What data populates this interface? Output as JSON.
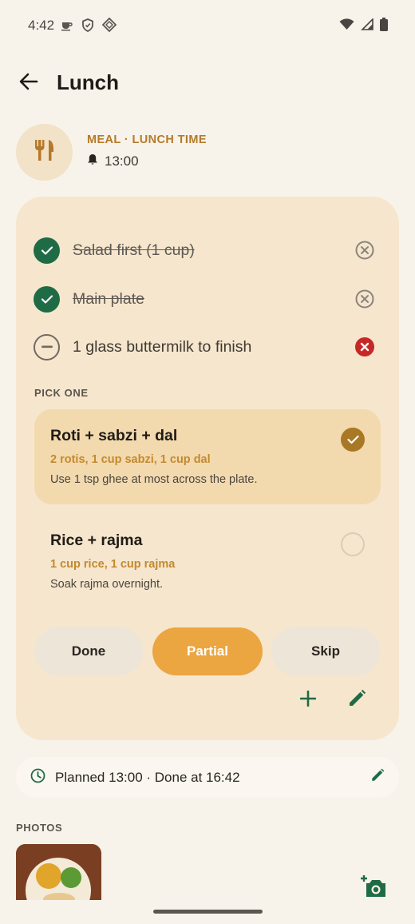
{
  "status_bar": {
    "time": "4:42",
    "left_icons": [
      "coffee-icon",
      "shield-icon",
      "diamond-icon"
    ],
    "right_icons": [
      "wifi-icon",
      "cellular-icon",
      "battery-icon"
    ]
  },
  "header": {
    "title": "Lunch",
    "back_icon": "arrow-back-icon"
  },
  "meal": {
    "kind_label": "MEAL · LUNCH TIME",
    "reminder_time": "13:00",
    "avatar_icon": "fork-knife-icon"
  },
  "checklist": [
    {
      "label": "Salad first (1 cup)",
      "state": "done",
      "action_icon": "remove-circle-outline-icon"
    },
    {
      "label": "Main plate",
      "state": "done",
      "action_icon": "remove-circle-outline-icon"
    },
    {
      "label": "1 glass buttermilk to finish",
      "state": "pending",
      "action_icon": "remove-circle-filled-icon"
    }
  ],
  "pick_one": {
    "label": "PICK ONE",
    "options": [
      {
        "title": "Roti + sabzi + dal",
        "portion": "2 rotis, 1 cup sabzi, 1 cup dal",
        "note": "Use 1 tsp ghee at most across the plate.",
        "selected": true
      },
      {
        "title": "Rice + rajma",
        "portion": "1 cup rice, 1 cup rajma",
        "note": "Soak rajma overnight.",
        "selected": false
      }
    ]
  },
  "status_buttons": {
    "done": "Done",
    "partial": "Partial",
    "skip": "Skip",
    "active": "partial"
  },
  "card_actions": [
    "add-icon",
    "edit-icon"
  ],
  "planned": {
    "text": "Planned 13:00 · Done at 16:42",
    "icon": "clock-icon",
    "edit_icon": "edit-icon"
  },
  "photos": {
    "label": "PHOTOS",
    "add_icon": "add-photo-icon"
  },
  "colors": {
    "background": "#f8f3ea",
    "card": "#f6e6cd",
    "accent_green": "#1f6b45",
    "accent_orange": "#eba641",
    "accent_gold": "#b5792a",
    "danger_red": "#c62828"
  }
}
